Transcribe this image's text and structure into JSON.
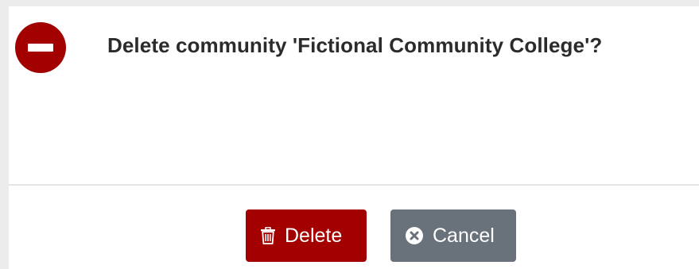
{
  "dialog": {
    "message": "Delete community 'Fictional Community College'?",
    "icon": "no-entry-icon"
  },
  "buttons": {
    "delete": {
      "label": "Delete",
      "icon": "trash-icon",
      "color": "#a30000"
    },
    "cancel": {
      "label": "Cancel",
      "icon": "close-circle-icon",
      "color": "#69727b"
    }
  }
}
